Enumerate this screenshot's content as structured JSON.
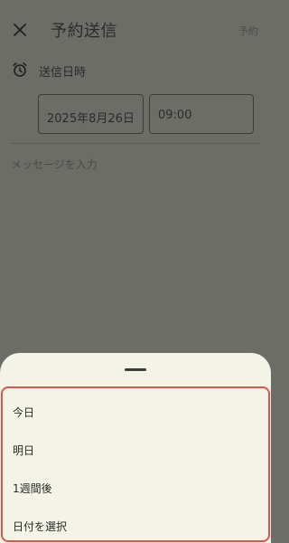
{
  "header": {
    "title": "予約送信",
    "close_icon": "close-icon",
    "action_label": "予約"
  },
  "datetime": {
    "icon": "alarm-clock-icon",
    "label": "送信日時",
    "date_value": "2025年8月26日",
    "time_value": "09:00"
  },
  "message": {
    "placeholder": "メッセージを入力"
  },
  "sheet": {
    "options": [
      {
        "label": "今日"
      },
      {
        "label": "明日"
      },
      {
        "label": "1週間後"
      },
      {
        "label": "日付を選択"
      }
    ]
  },
  "colors": {
    "scrim_background": "#6d6d68",
    "sheet_background": "#f3f3e8",
    "highlight_border": "#e05545"
  }
}
